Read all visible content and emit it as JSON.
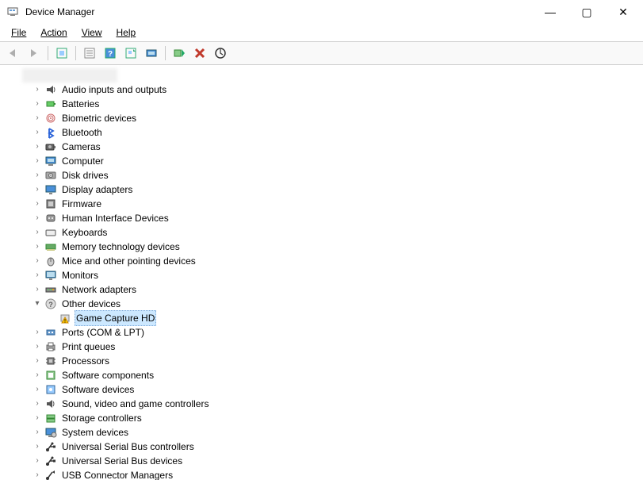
{
  "window": {
    "title": "Device Manager",
    "buttons": {
      "min": "—",
      "max": "▢",
      "close": "✕"
    }
  },
  "menu": {
    "file": "File",
    "action": "Action",
    "view": "View",
    "help": "Help"
  },
  "toolbar": {
    "back": "back",
    "forward": "forward",
    "show_hidden": "show-hidden",
    "properties": "properties",
    "help": "help",
    "refresh": "refresh",
    "monitor": "monitor",
    "add_legacy": "add-legacy",
    "uninstall": "uninstall",
    "scan": "scan"
  },
  "tree": {
    "root": "(computer name)",
    "nodes": [
      {
        "label": "Audio inputs and outputs",
        "icon": "audio"
      },
      {
        "label": "Batteries",
        "icon": "battery"
      },
      {
        "label": "Biometric devices",
        "icon": "biometric"
      },
      {
        "label": "Bluetooth",
        "icon": "bluetooth"
      },
      {
        "label": "Cameras",
        "icon": "camera"
      },
      {
        "label": "Computer",
        "icon": "computer"
      },
      {
        "label": "Disk drives",
        "icon": "disk"
      },
      {
        "label": "Display adapters",
        "icon": "display"
      },
      {
        "label": "Firmware",
        "icon": "firmware"
      },
      {
        "label": "Human Interface Devices",
        "icon": "hid"
      },
      {
        "label": "Keyboards",
        "icon": "keyboard"
      },
      {
        "label": "Memory technology devices",
        "icon": "memory"
      },
      {
        "label": "Mice and other pointing devices",
        "icon": "mouse"
      },
      {
        "label": "Monitors",
        "icon": "monitor"
      },
      {
        "label": "Network adapters",
        "icon": "network"
      },
      {
        "label": "Other devices",
        "icon": "other",
        "expanded": true,
        "children": [
          {
            "label": "Game Capture HD",
            "icon": "warning",
            "selected": true
          }
        ]
      },
      {
        "label": "Ports (COM & LPT)",
        "icon": "port"
      },
      {
        "label": "Print queues",
        "icon": "printer"
      },
      {
        "label": "Processors",
        "icon": "cpu"
      },
      {
        "label": "Software components",
        "icon": "swcomp"
      },
      {
        "label": "Software devices",
        "icon": "swdev"
      },
      {
        "label": "Sound, video and game controllers",
        "icon": "sound"
      },
      {
        "label": "Storage controllers",
        "icon": "storage"
      },
      {
        "label": "System devices",
        "icon": "system"
      },
      {
        "label": "Universal Serial Bus controllers",
        "icon": "usb"
      },
      {
        "label": "Universal Serial Bus devices",
        "icon": "usb"
      },
      {
        "label": "USB Connector Managers",
        "icon": "usbconn"
      }
    ]
  }
}
